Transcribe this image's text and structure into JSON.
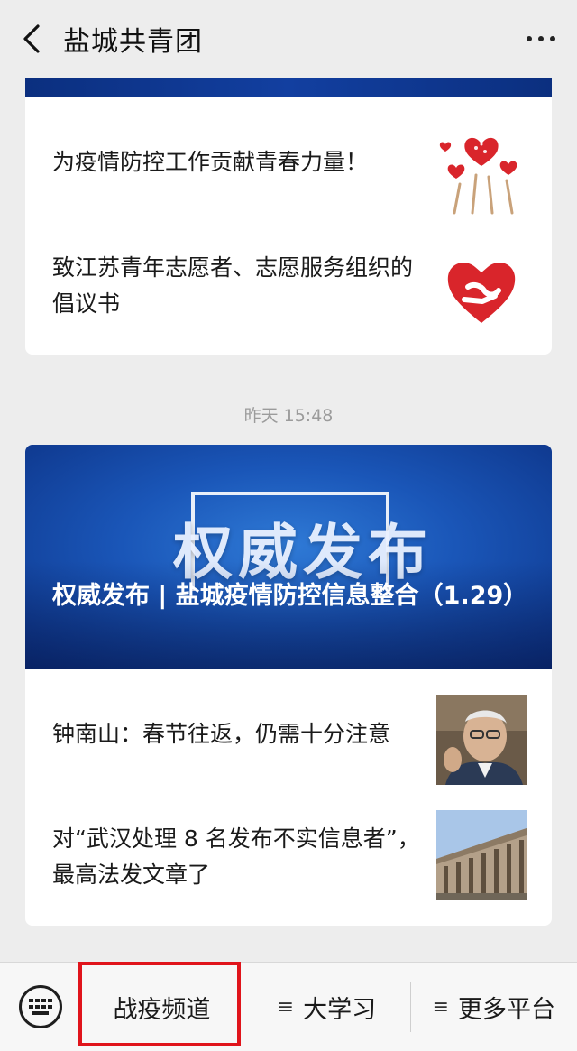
{
  "header": {
    "title": "盐城共青团",
    "back_icon": "chevron-left-icon",
    "more_icon": "more-dots-icon"
  },
  "card1": {
    "items": [
      {
        "title": "为疫情防控工作贡献青春力量！",
        "thumb": "hands-hearts-image"
      },
      {
        "title": "致江苏青年志愿者、志愿服务组织的倡议书",
        "thumb": "volunteer-heart-logo"
      }
    ]
  },
  "timestamp": "昨天 15:48",
  "card2": {
    "banner": {
      "word": "权威发布",
      "title": "权威发布 | 盐城疫情防控信息整合（1.29）"
    },
    "items": [
      {
        "title": "钟南山：春节往返，仍需十分注意",
        "thumb": "portrait-photo"
      },
      {
        "title": "对“武汉处理 8 名发布不实信息者”，最高法发文章了",
        "thumb": "court-building-photo"
      }
    ]
  },
  "bottom_bar": {
    "keyboard_icon": "keyboard-icon",
    "tabs": [
      {
        "label": "战疫频道"
      },
      {
        "label": "大学习",
        "icon": "menu-lines-icon"
      },
      {
        "label": "更多平台",
        "icon": "menu-lines-icon"
      }
    ]
  },
  "colors": {
    "background": "#ededed",
    "banner_blue": "#1a56b8",
    "highlight_red": "#e0141b",
    "volunteer_red": "#d9252b"
  }
}
